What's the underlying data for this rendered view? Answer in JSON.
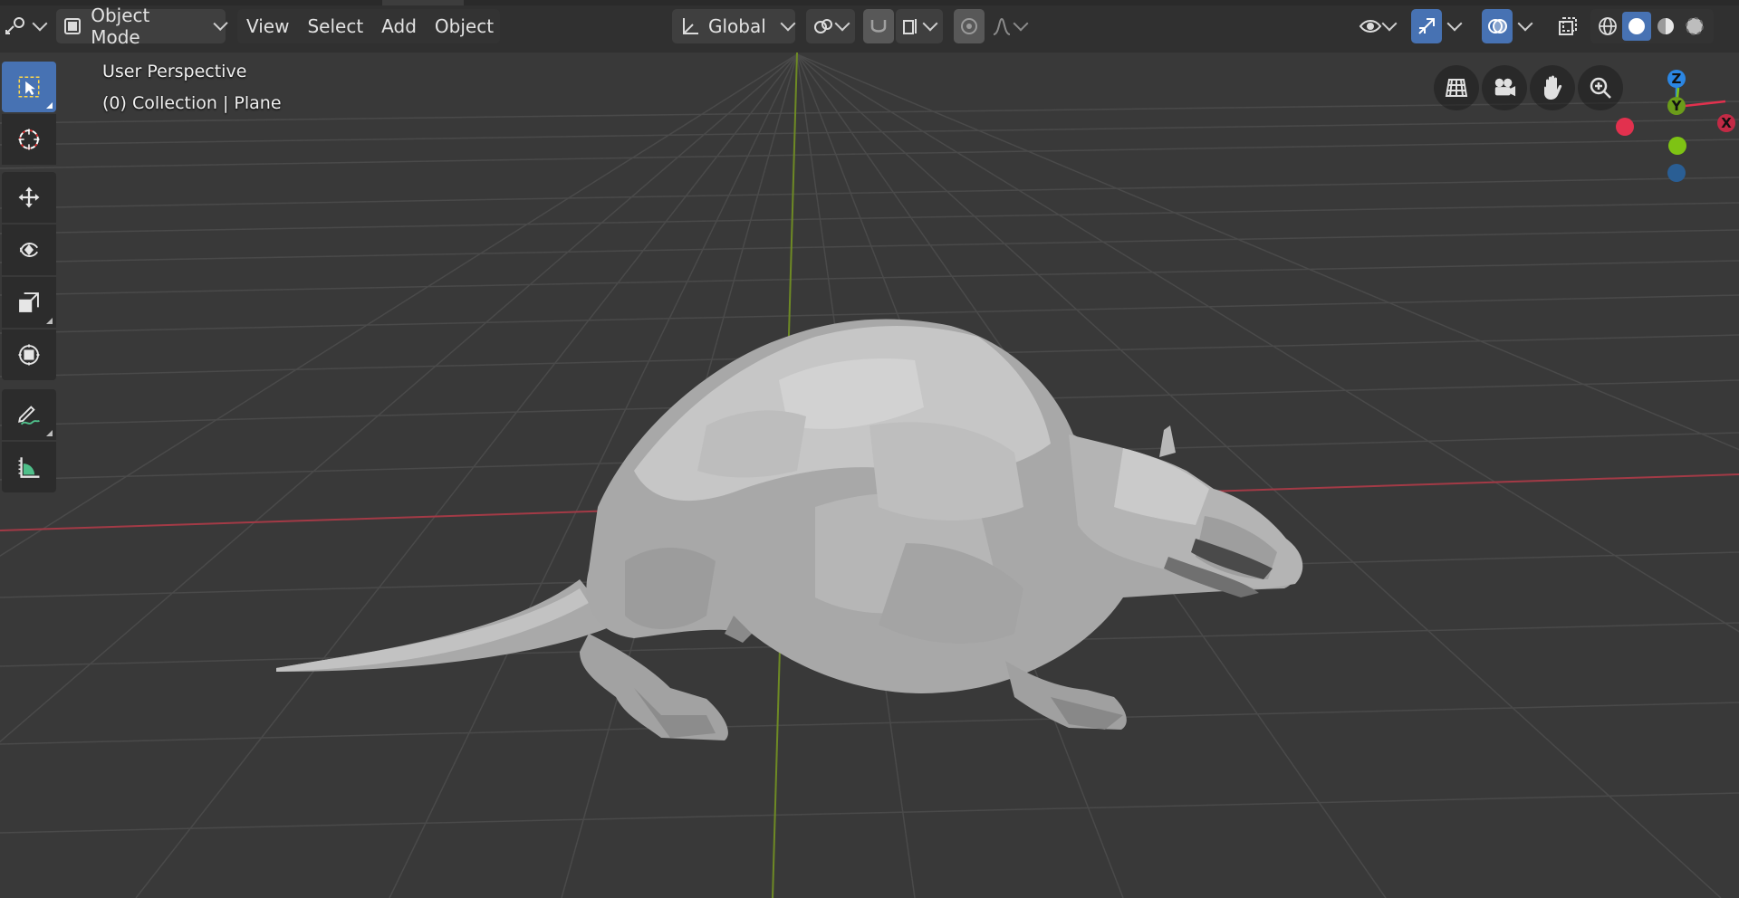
{
  "header": {
    "mode": "Object Mode",
    "menus": [
      "View",
      "Select",
      "Add",
      "Object"
    ],
    "transform_orientation": "Global"
  },
  "overlay": {
    "view_name": "User Perspective",
    "collection_info": "(0) Collection | Plane"
  },
  "gizmo": {
    "z_label": "Z",
    "x_label": "X",
    "y_label": "Y",
    "colors": {
      "x": "#e2314e",
      "y": "#7ec314",
      "z": "#2b86e3",
      "neg_y": "#2a5e94"
    }
  },
  "toolbar": {
    "tools": [
      "select-box-icon",
      "cursor-icon",
      "move-icon",
      "rotate-icon",
      "scale-icon",
      "transform-icon",
      "annotate-icon",
      "measure-icon"
    ]
  },
  "navigation": [
    "perspective-grid-icon",
    "camera-icon",
    "hand-pan-icon",
    "zoom-icon"
  ],
  "colors": {
    "background": "#393939",
    "grid": "#4a4a4a",
    "x_axis": "#a33a46",
    "y_axis": "#6e8a24",
    "accent": "#4772b3",
    "model": "#b0b0b0"
  }
}
